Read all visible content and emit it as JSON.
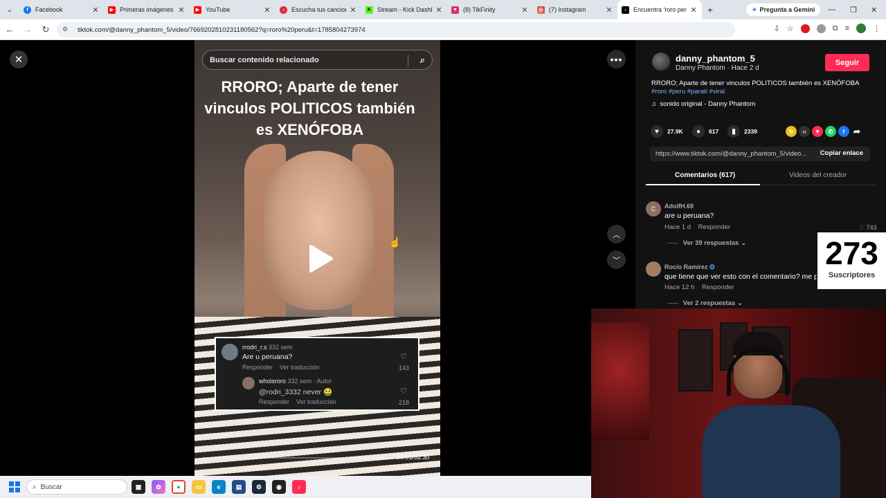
{
  "browser": {
    "tabs": [
      {
        "title": "Facebook",
        "icon": "facebook-icon",
        "color": "#1877f2"
      },
      {
        "title": "Primeras imágenes de",
        "icon": "youtube-icon",
        "color": "#ff0000"
      },
      {
        "title": "YouTube",
        "icon": "youtube-icon",
        "color": "#ff0000"
      },
      {
        "title": "Escucha tus canciones",
        "icon": "music-icon",
        "color": "#e3263b"
      },
      {
        "title": "Stream - Kick Dashbo",
        "icon": "kick-icon",
        "color": "#53fc18"
      },
      {
        "title": "(8) TikFinity",
        "icon": "tikfinity-icon",
        "color": "#d6336c"
      },
      {
        "title": "(7) Instagram",
        "icon": "instagram-icon",
        "color": "#c13584"
      },
      {
        "title": "Encuentra 'roro peru'",
        "icon": "tiktok-icon",
        "color": "#000000"
      }
    ],
    "gemini_label": "Pregunta a Gemini",
    "url": "tiktok.com/@danny_phantom_5/video/7669202810231180562?q=roro%20peru&t=1785804273974"
  },
  "video": {
    "search_placeholder": "Buscar contenido relacionado",
    "title": "RRORO; Aparte de tener vinculos POLITICOS también es XENÓFOBA",
    "comment1_user": "rrodri_r.s",
    "comment1_meta": "332 sem",
    "comment1_text": "Are u peruana?",
    "comment1_reply": "Responder",
    "comment1_translate": "Ver traducción",
    "comment1_likes": "143",
    "comment2_user": "whoisroro",
    "comment2_meta": "332 sem · Autor",
    "comment2_text": "@rodri_3332 never 🤮",
    "comment2_reply": "Responder",
    "comment2_translate": "Ver traducción",
    "comment2_likes": "218",
    "time": "00:01/02:30",
    "progress": 0.007
  },
  "author": {
    "username": "danny_phantom_5",
    "subtitle": "Danny Phantom · Hace 2 d",
    "follow_label": "Seguir",
    "description": "RRORO; Aparte de tener vinculos POLITICOS también es XENÓFOBA",
    "tags": "#roro #peru #parati #viral",
    "sound": "sonido original - Danny Phantom"
  },
  "stats": {
    "likes": "27.9K",
    "comments": "617",
    "saves": "2339"
  },
  "link": {
    "url": "https://www.tiktok.com/@danny_phantom_5/video...",
    "copy_label": "Copiar enlace"
  },
  "panel_tabs": {
    "comments": "Comentarios (617)",
    "creator": "Videos del creador"
  },
  "comments": [
    {
      "initial": "C",
      "user": "AdolfH.69",
      "text": "are u peruana?",
      "time": "Hace 1 d",
      "reply": "Responder",
      "likes": "743",
      "replies": "Ver 39 respuestas"
    },
    {
      "initial": "",
      "user": "Rocío Ramírez",
      "text": "que tiene que ver esto con el comentario? me pe",
      "time": "Hace 12 h",
      "reply": "Responder",
      "likes": "",
      "replies": "Ver 2 respuestas"
    }
  ],
  "overlay": {
    "subs_count": "273",
    "subs_label": "Suscriptores"
  },
  "taskbar": {
    "search_label": "Buscar"
  },
  "colors": {
    "accent": "#fe2c55",
    "tag": "#7fb3ff"
  }
}
